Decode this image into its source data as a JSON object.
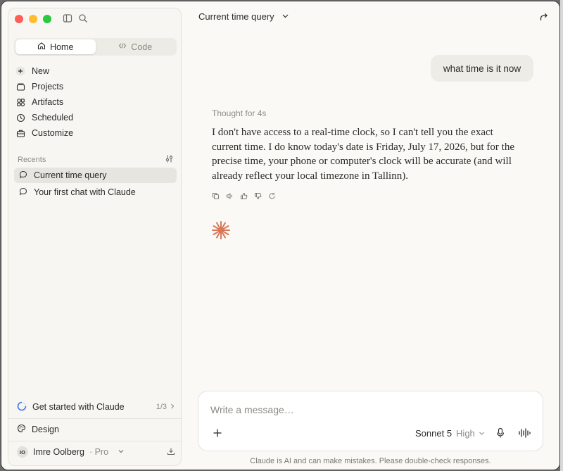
{
  "sidebar": {
    "tabs": [
      {
        "label": "Home",
        "icon": "home-icon",
        "active": true
      },
      {
        "label": "Code",
        "icon": "code-icon",
        "active": false
      }
    ],
    "nav": [
      {
        "label": "New",
        "icon": "plus-icon"
      },
      {
        "label": "Projects",
        "icon": "folder-icon"
      },
      {
        "label": "Artifacts",
        "icon": "artifacts-icon"
      },
      {
        "label": "Scheduled",
        "icon": "clock-icon"
      },
      {
        "label": "Customize",
        "icon": "briefcase-icon"
      }
    ],
    "recents_label": "Recents",
    "recents": [
      {
        "label": "Current time query",
        "active": true
      },
      {
        "label": "Your first chat with Claude",
        "active": false
      }
    ],
    "get_started": {
      "label": "Get started with Claude",
      "progress": "1/3"
    },
    "design_label": "Design",
    "user": {
      "initials": "IO",
      "name": "Imre Oolberg",
      "plan": "· Pro"
    }
  },
  "conversation": {
    "title": "Current time query",
    "user_message": "what time is it now",
    "thought_label": "Thought for 4s",
    "assistant_message": "I don't have access to a real-time clock, so I can't tell you the exact current time. I do know today's date is Friday, July 17, 2026, but for the precise time, your phone or computer's clock will be accurate (and will already reflect your local timezone in Tallinn)."
  },
  "composer": {
    "placeholder": "Write a message…",
    "model": "Sonnet 5",
    "effort": "High"
  },
  "disclaimer": "Claude is AI and can make mistakes. Please double-check responses.",
  "colors": {
    "accent": "#d97757",
    "background": "#faf9f6",
    "sidebar": "#f7f6f2"
  }
}
